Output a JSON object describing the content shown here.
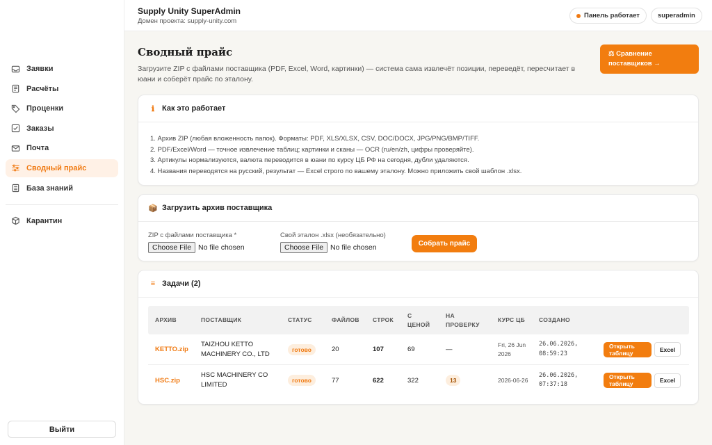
{
  "header": {
    "title": "Supply Unity SuperAdmin",
    "domain": "Домен проекта: supply-unity.com",
    "status_label": "Панель работает",
    "user_label": "superadmin"
  },
  "sidebar": {
    "items": [
      {
        "label": "Заявки",
        "icon": "inbox-icon",
        "active": false
      },
      {
        "label": "Расчёты",
        "icon": "document-icon",
        "active": false
      },
      {
        "label": "Проценки",
        "icon": "tag-icon",
        "active": false
      },
      {
        "label": "Заказы",
        "icon": "checkbox-icon",
        "active": false
      },
      {
        "label": "Почта",
        "icon": "mail-icon",
        "active": false
      },
      {
        "label": "Сводный прайс",
        "icon": "sliders-icon",
        "active": true
      },
      {
        "label": "База знаний",
        "icon": "book-icon",
        "active": false
      },
      {
        "label": "Карантин",
        "icon": "box-icon",
        "active": false
      }
    ],
    "logout_label": "Выйти"
  },
  "page": {
    "title": "Сводный прайс",
    "description": "Загрузите ZIP с файлами поставщика (PDF, Excel, Word, картинки) — система сама извлечёт позиции, переведёт, пересчитает в юани и соберёт прайс по эталону.",
    "compare_button": "⚖ Сравнение поставщиков →"
  },
  "how_it_works": {
    "icon": "info-icon",
    "title": "Как это работает",
    "steps": [
      "1. Архив ZIP (любая вложенность папок). Форматы: PDF, XLS/XLSX, CSV, DOC/DOCX, JPG/PNG/BMP/TIFF.",
      "2. PDF/Excel/Word — точное извлечение таблиц; картинки и сканы — OCR (ru/en/zh, цифры проверяйте).",
      "3. Артикулы нормализуются, валюта переводится в юани по курсу ЦБ РФ на сегодня, дубли удаляются.",
      "4. Названия переводятся на русский, результат — Excel строго по вашему эталону. Можно приложить свой шаблон .xlsx."
    ]
  },
  "upload": {
    "icon": "package-icon",
    "icon_glyph": "📦",
    "title": "Загрузить архив поставщика",
    "zip_label": "ZIP с файлами поставщика *",
    "template_label": "Свой эталон .xlsx (необязательно)",
    "choose_file": "Choose File",
    "no_file": "No file chosen",
    "build_button": "Собрать прайс"
  },
  "tasks": {
    "icon": "list-icon",
    "icon_glyph": "≡",
    "title": "Задачи (2)",
    "columns": [
      "АРХИВ",
      "ПОСТАВЩИК",
      "СТАТУС",
      "ФАЙЛОВ",
      "СТРОК",
      "С\nЦЕНОЙ",
      "НА\nПРОВЕРКУ",
      "КУРС ЦБ",
      "СОЗДАНО",
      ""
    ],
    "rows": [
      {
        "archive": "KETTO.zip",
        "supplier": "TAIZHOU KETTO MACHINERY CO., LTD",
        "status": "готово",
        "files": "20",
        "lines": "107",
        "with_price": "69",
        "to_review": "—",
        "rate": "Fri, 26 Jun 2026",
        "created": "26.06.2026, 08:59:23",
        "open_label": "Открыть таблицу",
        "excel_label": "Excel"
      },
      {
        "archive": "HSC.zip",
        "supplier": "HSC MACHINERY CO LIMITED",
        "status": "готово",
        "files": "77",
        "lines": "622",
        "with_price": "322",
        "to_review": "13",
        "rate": "2026-06-26",
        "created": "26.06.2026, 07:37:18",
        "open_label": "Открыть таблицу",
        "excel_label": "Excel"
      }
    ]
  },
  "colors": {
    "accent": "#f27d0f",
    "accent_soft": "#fff1e6",
    "background": "#f7f6f2"
  }
}
